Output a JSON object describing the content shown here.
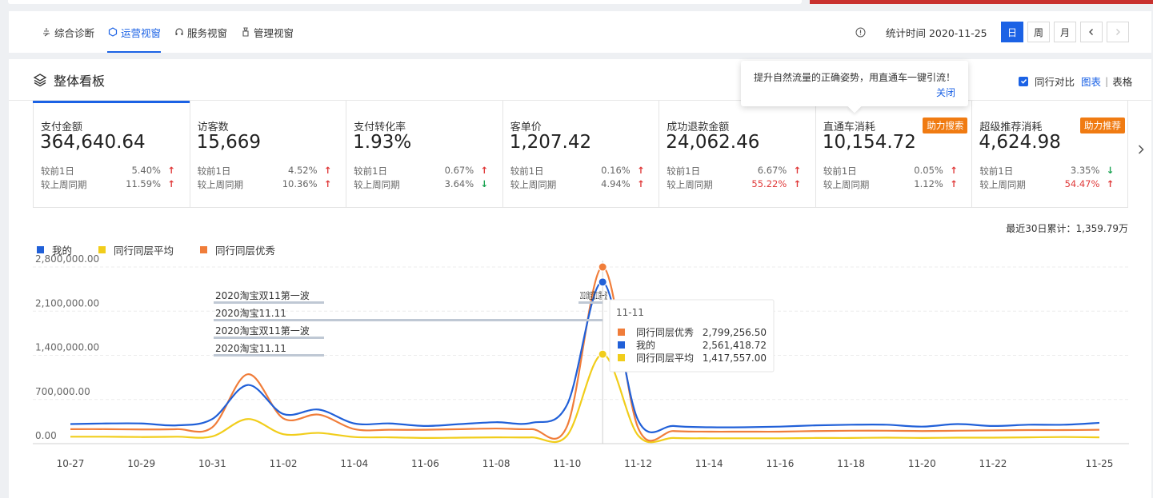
{
  "nav": {
    "tabs": [
      {
        "label": "综合诊断",
        "icon": "diagnosis-icon"
      },
      {
        "label": "运营视窗",
        "icon": "operation-icon",
        "active": true
      },
      {
        "label": "服务视窗",
        "icon": "headset-icon"
      },
      {
        "label": "管理视窗",
        "icon": "manage-icon"
      }
    ],
    "stat_time_label": "统计时间 2020-11-25",
    "periods": [
      "日",
      "周",
      "月"
    ],
    "active_period": "日"
  },
  "panel": {
    "title": "整体看板",
    "compare_label": "同行对比",
    "view_chart": "图表",
    "view_divider": "|",
    "view_table": "表格",
    "tooltip_text": "提升自然流量的正确姿势，用直通车一键引流！",
    "tooltip_close": "关闭",
    "total_label": "最近30日累计：1,359.79万"
  },
  "metrics": [
    {
      "label": "支付金额",
      "value": "364,640.64",
      "d1": "5.40%",
      "d1_dir": "up",
      "w1": "11.59%",
      "w1_dir": "up",
      "w1_red": false
    },
    {
      "label": "访客数",
      "value": "15,669",
      "d1": "4.52%",
      "d1_dir": "up",
      "w1": "10.36%",
      "w1_dir": "up",
      "w1_red": false
    },
    {
      "label": "支付转化率",
      "value": "1.93%",
      "d1": "0.67%",
      "d1_dir": "up",
      "w1": "3.64%",
      "w1_dir": "down",
      "w1_red": false
    },
    {
      "label": "客单价",
      "value": "1,207.42",
      "d1": "0.16%",
      "d1_dir": "up",
      "w1": "4.94%",
      "w1_dir": "up",
      "w1_red": false
    },
    {
      "label": "成功退款金额",
      "value": "24,062.46",
      "d1": "6.67%",
      "d1_dir": "up",
      "w1": "55.22%",
      "w1_dir": "up",
      "w1_red": true
    },
    {
      "label": "直通车消耗",
      "value": "10,154.72",
      "d1": "0.05%",
      "d1_dir": "up",
      "w1": "1.12%",
      "w1_dir": "up",
      "w1_red": false,
      "badge": "助力搜索"
    },
    {
      "label": "超级推荐消耗",
      "value": "4,624.98",
      "d1": "3.35%",
      "d1_dir": "down",
      "w1": "54.47%",
      "w1_dir": "up",
      "w1_red": true,
      "badge": "助力推荐"
    }
  ],
  "compare_labels": {
    "day": "较前1日",
    "week": "较上周同期"
  },
  "chart_data": {
    "type": "line",
    "x": [
      "10-27",
      "10-28",
      "10-29",
      "10-30",
      "10-31",
      "11-01",
      "11-02",
      "11-03",
      "11-04",
      "11-05",
      "11-06",
      "11-07",
      "11-08",
      "11-09",
      "11-10",
      "11-11",
      "11-12",
      "11-13",
      "11-14",
      "11-15",
      "11-16",
      "11-17",
      "11-18",
      "11-19",
      "11-20",
      "11-21",
      "11-22",
      "11-23",
      "11-24",
      "11-25"
    ],
    "x_tick_labels": [
      "10-27",
      "10-29",
      "10-31",
      "11-02",
      "11-04",
      "11-06",
      "11-08",
      "11-10",
      "11-12",
      "11-14",
      "11-16",
      "11-18",
      "11-20",
      "11-22",
      "11-25"
    ],
    "ylim": [
      0,
      2800000
    ],
    "y_ticks": [
      "0.00",
      "700,000.00",
      "1,400,000.00",
      "2,100,000.00",
      "2,800,000.00"
    ],
    "grid": true,
    "legend_position": "top-left",
    "series": [
      {
        "name": "我的",
        "color": "#2160d8",
        "values": [
          310000,
          320000,
          320000,
          290000,
          390000,
          930000,
          470000,
          540000,
          320000,
          320000,
          280000,
          310000,
          340000,
          330000,
          620000,
          2561418.72,
          370000,
          280000,
          260000,
          260000,
          270000,
          290000,
          300000,
          300000,
          270000,
          310000,
          280000,
          300000,
          300000,
          330000
        ]
      },
      {
        "name": "同行同层平均",
        "color": "#f1cd1b",
        "values": [
          110000,
          110000,
          105000,
          110000,
          115000,
          390000,
          150000,
          170000,
          105000,
          100000,
          90000,
          95000,
          100000,
          100000,
          130000,
          1417557.0,
          130000,
          90000,
          85000,
          85000,
          85000,
          90000,
          90000,
          95000,
          90000,
          95000,
          95000,
          100000,
          105000,
          100000
        ]
      },
      {
        "name": "同行同层优秀",
        "color": "#f07d3a",
        "values": [
          230000,
          230000,
          225000,
          230000,
          260000,
          1100000,
          400000,
          460000,
          230000,
          220000,
          220000,
          230000,
          240000,
          230000,
          280000,
          2799256.5,
          250000,
          200000,
          190000,
          190000,
          190000,
          200000,
          205000,
          205000,
          200000,
          205000,
          210000,
          215000,
          215000,
          220000
        ]
      }
    ],
    "annotations": [
      {
        "text": "2020淘宝双11第一波"
      },
      {
        "text": "2020淘宝11.11"
      },
      {
        "text": "2020淘宝双11第一波"
      },
      {
        "text": "2020淘宝11.11"
      },
      {
        "text": "2020淘宝双11第一波"
      }
    ],
    "tooltip": {
      "date": "11-11",
      "rows": [
        {
          "name": "同行同层优秀",
          "value": "2,799,256.50",
          "color": "#f07d3a"
        },
        {
          "name": "我的",
          "value": "2,561,418.72",
          "color": "#2160d8"
        },
        {
          "name": "同行同层平均",
          "value": "1,417,557.00",
          "color": "#f1cd1b"
        }
      ]
    }
  }
}
